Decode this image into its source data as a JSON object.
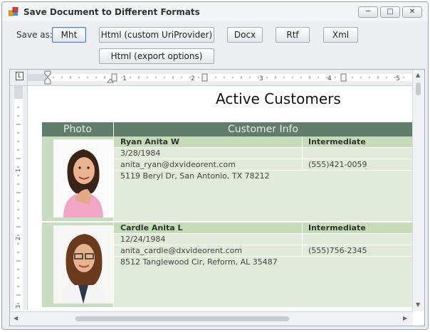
{
  "window": {
    "title": "Save Document to Different Formats"
  },
  "toolbar": {
    "save_as_label": "Save as:",
    "buttons": {
      "mht": "Mht",
      "html_custom": "Html (custom UriProvider)",
      "docx": "Docx",
      "rtf": "Rtf",
      "xml": "Xml",
      "html_export": "Html (export options)"
    }
  },
  "ruler": {
    "corner": "L",
    "h_numbers": [
      "1",
      "2",
      "3",
      "4",
      "5"
    ],
    "v_numbers": [
      "1",
      "2",
      "3"
    ]
  },
  "document": {
    "title": "Active Customers",
    "headers": {
      "photo": "Photo",
      "info": "Customer Info"
    },
    "customers": [
      {
        "name": "Ryan Anita W",
        "level": "Intermediate",
        "birth": "3/28/1984",
        "email": "anita_ryan@dxvideorent.com",
        "phone": "(555)421-0059",
        "address": "5119 Beryl Dr, San Antonio, TX 78212"
      },
      {
        "name": "Cardle Anita L",
        "level": "Intermediate",
        "birth": "12/24/1984",
        "email": "anita_cardle@dxvideorent.com",
        "phone": "(555)756-2345",
        "address": "8512 Tanglewood Cir,  Reform, AL 35487"
      }
    ]
  }
}
